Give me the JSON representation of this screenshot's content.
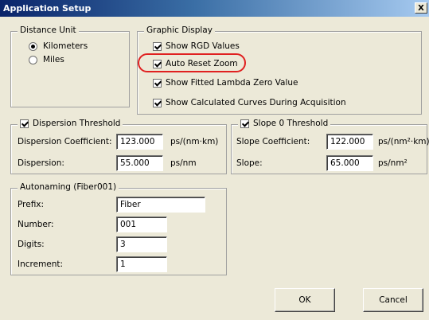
{
  "window": {
    "title": "Application Setup",
    "close_label": "X"
  },
  "distance_unit": {
    "title": "Distance Unit",
    "options": [
      {
        "label": "Kilometers",
        "selected": true
      },
      {
        "label": "Miles",
        "selected": false
      }
    ]
  },
  "graphic_display": {
    "title": "Graphic Display",
    "options": [
      {
        "label": "Show RGD Values",
        "checked": true
      },
      {
        "label": "Auto Reset Zoom",
        "checked": true,
        "highlighted": true
      },
      {
        "label": "Show Fitted Lambda Zero Value",
        "checked": true
      },
      {
        "label": "Show Calculated Curves During Acquisition",
        "checked": true
      }
    ],
    "highlight_color": "#e02020"
  },
  "dispersion_threshold": {
    "title": "Dispersion Threshold",
    "checked": true,
    "coefficient_label": "Dispersion Coefficient:",
    "coefficient_value": "123.000",
    "coefficient_unit": "ps/(nm·km)",
    "dispersion_label": "Dispersion:",
    "dispersion_value": "55.000",
    "dispersion_unit": "ps/nm"
  },
  "slope_threshold": {
    "title": "Slope 0 Threshold",
    "checked": true,
    "coefficient_label": "Slope Coefficient:",
    "coefficient_value": "122.000",
    "coefficient_unit": "ps/(nm²·km)",
    "slope_label": "Slope:",
    "slope_value": "65.000",
    "slope_unit": "ps/nm²"
  },
  "autonaming": {
    "title": "Autonaming (Fiber001)",
    "prefix_label": "Prefix:",
    "prefix_value": "Fiber",
    "number_label": "Number:",
    "number_value": "001",
    "digits_label": "Digits:",
    "digits_value": "3",
    "increment_label": "Increment:",
    "increment_value": "1"
  },
  "buttons": {
    "ok": "OK",
    "cancel": "Cancel"
  }
}
